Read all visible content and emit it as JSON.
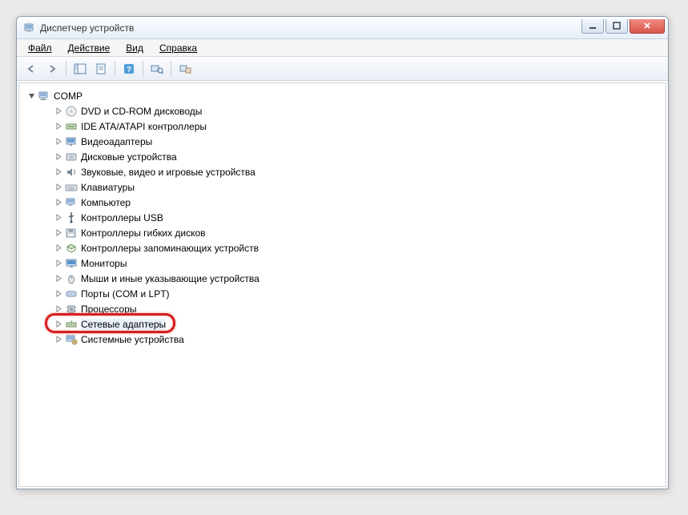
{
  "window": {
    "title": "Диспетчер устройств"
  },
  "menu": {
    "file": "Файл",
    "action": "Действие",
    "view": "Вид",
    "help": "Справка"
  },
  "tree": {
    "root": "COMP",
    "items": [
      {
        "label": "DVD и CD-ROM дисководы",
        "icon": "disc"
      },
      {
        "label": "IDE ATA/ATAPI контроллеры",
        "icon": "ide"
      },
      {
        "label": "Видеоадаптеры",
        "icon": "display"
      },
      {
        "label": "Дисковые устройства",
        "icon": "hdd"
      },
      {
        "label": "Звуковые, видео и игровые устройства",
        "icon": "sound"
      },
      {
        "label": "Клавиатуры",
        "icon": "keyboard"
      },
      {
        "label": "Компьютер",
        "icon": "computer"
      },
      {
        "label": "Контроллеры USB",
        "icon": "usb"
      },
      {
        "label": "Контроллеры гибких дисков",
        "icon": "floppy-ctrl"
      },
      {
        "label": "Контроллеры запоминающих устройств",
        "icon": "storage-ctrl"
      },
      {
        "label": "Мониторы",
        "icon": "monitor"
      },
      {
        "label": "Мыши и иные указывающие устройства",
        "icon": "mouse"
      },
      {
        "label": "Порты (COM и LPT)",
        "icon": "port"
      },
      {
        "label": "Процессоры",
        "icon": "cpu"
      },
      {
        "label": "Сетевые адаптеры",
        "icon": "network",
        "highlighted": true
      },
      {
        "label": "Системные устройства",
        "icon": "system"
      }
    ]
  }
}
